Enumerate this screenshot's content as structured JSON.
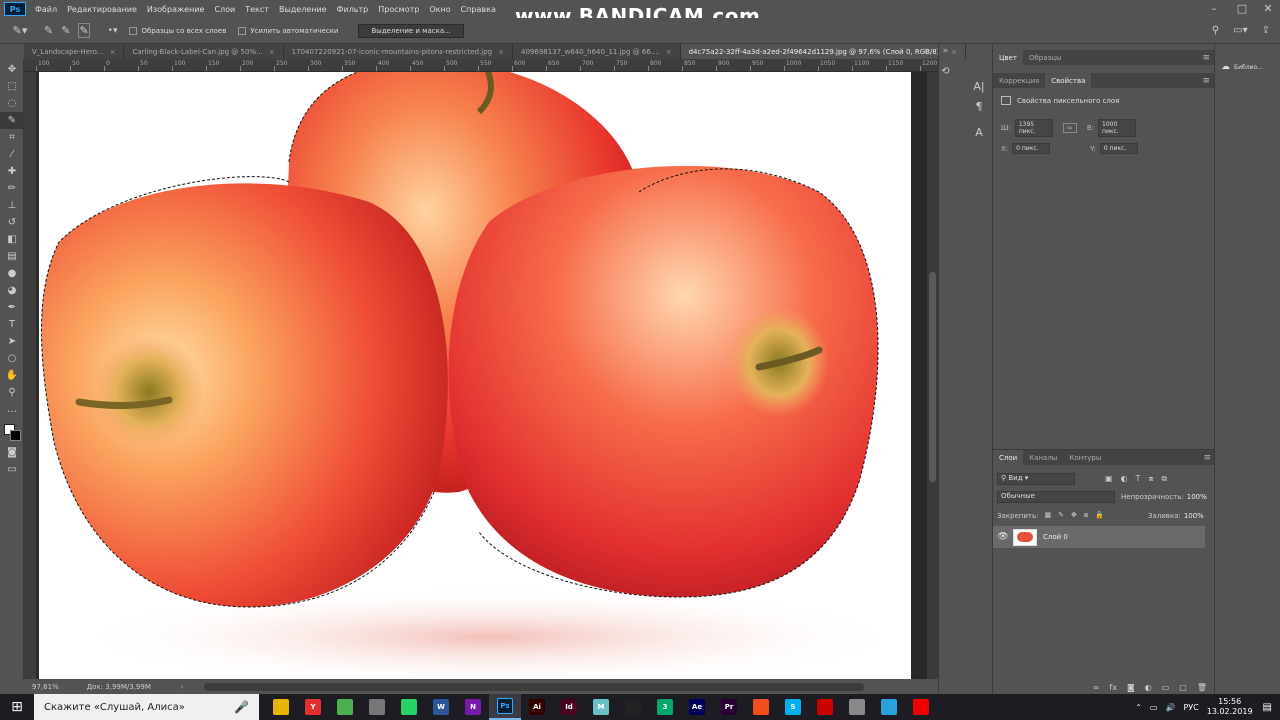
{
  "app": {
    "logo": "Ps",
    "menu": [
      "Файл",
      "Редактирование",
      "Изображение",
      "Слои",
      "Текст",
      "Выделение",
      "Фильтр",
      "Просмотр",
      "Окно",
      "Справка"
    ]
  },
  "watermark": "www.BANDICAM.com",
  "options": {
    "sample_all": "Образцы со всех слоев",
    "auto_enhance": "Усилить автоматически",
    "select_mask": "Выделение и маска..."
  },
  "tabs": [
    {
      "label": "V_Landscape-Hero...",
      "active": false
    },
    {
      "label": "Carling-Black-Label-Can.jpg @ 50%...",
      "active": false
    },
    {
      "label": "170407220921-07-iconic-mountains-pitons-restricted.jpg",
      "active": false
    },
    {
      "label": "409698137_w640_h640_11.jpg @ 66....",
      "active": false
    },
    {
      "label": "d4c75a22-32ff-4a3d-a2ed-2f49642d1129.jpg @ 97,6% (Слой 0, RGB/8) *",
      "active": true
    }
  ],
  "ruler_ticks": [
    "100",
    "50",
    "0",
    "50",
    "100",
    "150",
    "200",
    "250",
    "300",
    "350",
    "400",
    "450",
    "500",
    "550",
    "600",
    "650",
    "700",
    "750",
    "800",
    "850",
    "900",
    "950",
    "1000",
    "1050",
    "1100",
    "1150",
    "1200",
    "1250",
    "1300"
  ],
  "status": {
    "zoom": "97,61%",
    "doc": "Док: 3,99M/3,99M"
  },
  "panel_top": {
    "tabs": [
      "Цвет",
      "Образцы"
    ],
    "tabs2": [
      "Коррекция",
      "Свойства"
    ],
    "title": "Свойства пиксельного слоя",
    "w_label": "Ш:",
    "w_value": "1395 пикс.",
    "h_label": "В:",
    "h_value": "1000 пикс.",
    "x_label": "X:",
    "x_value": "0 пикс.",
    "y_label": "Y:",
    "y_value": "0 пикс."
  },
  "library": "Библио...",
  "layers": {
    "tabs": [
      "Слои",
      "Каналы",
      "Контуры"
    ],
    "filter": "Вид",
    "blend": "Обычные",
    "opacity_label": "Непрозрачность:",
    "opacity": "100%",
    "lock_label": "Закрепить:",
    "fill_label": "Заливка:",
    "fill": "100%",
    "layer_name": "Слой 0"
  },
  "taskbar": {
    "search": "Скажите «Слушай, Алиса»",
    "lang": "РУС",
    "time": "15:56",
    "date": "13.02.2019",
    "apps": [
      {
        "label": "",
        "color": "#e8b600"
      },
      {
        "label": "Y",
        "color": "#e03030"
      },
      {
        "label": "",
        "color": "#4caf50"
      },
      {
        "label": "",
        "color": "#777"
      },
      {
        "label": "",
        "color": "#25d366"
      },
      {
        "label": "W",
        "color": "#2b579a"
      },
      {
        "label": "N",
        "color": "#7719aa"
      },
      {
        "label": "Ps",
        "color": "#001d34"
      },
      {
        "label": "Ai",
        "color": "#330000"
      },
      {
        "label": "Id",
        "color": "#49021f"
      },
      {
        "label": "M",
        "color": "#6bc0c7"
      },
      {
        "label": "",
        "color": "#222"
      },
      {
        "label": "3",
        "color": "#00a86b"
      },
      {
        "label": "Ae",
        "color": "#00005b"
      },
      {
        "label": "Pr",
        "color": "#2a0034"
      },
      {
        "label": "",
        "color": "#f24e1e"
      },
      {
        "label": "S",
        "color": "#00aff0"
      },
      {
        "label": "",
        "color": "#c00"
      },
      {
        "label": "",
        "color": "#888"
      },
      {
        "label": "",
        "color": "#2aa1da"
      },
      {
        "label": "",
        "color": "#e00"
      }
    ]
  }
}
